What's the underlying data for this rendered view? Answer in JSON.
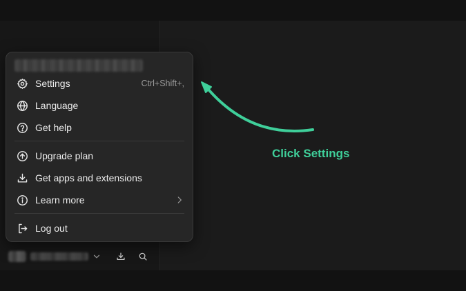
{
  "menu": {
    "items": [
      {
        "label": "Settings",
        "shortcut": "Ctrl+Shift+,"
      },
      {
        "label": "Language"
      },
      {
        "label": "Get help"
      },
      {
        "label": "Upgrade plan"
      },
      {
        "label": "Get apps and extensions"
      },
      {
        "label": "Learn more"
      },
      {
        "label": "Log out"
      }
    ]
  },
  "icons": {
    "settings": "gear-icon",
    "language": "globe-icon",
    "help": "question-circle-icon",
    "upgrade": "arrow-up-circle-icon",
    "apps": "download-icon",
    "learn": "info-circle-icon",
    "logout": "logout-icon",
    "submenu": "chevron-right-icon"
  },
  "annotation": {
    "text": "Click Settings",
    "color": "#3fcf9a"
  }
}
